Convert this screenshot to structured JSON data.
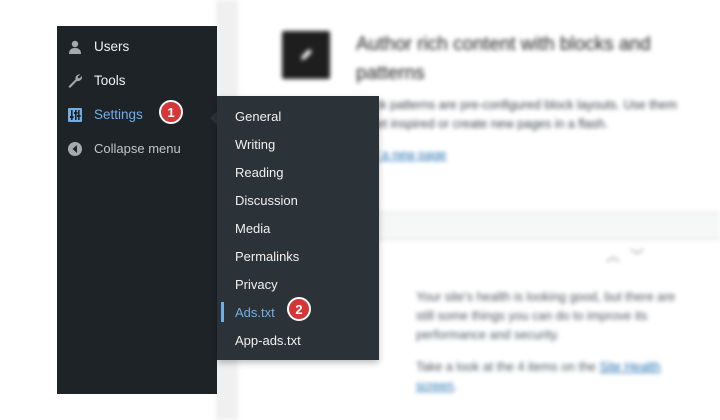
{
  "background": {
    "heading": "Author rich content with blocks and patterns",
    "paragraph": "Block patterns are pre-configured block layouts. Use them to get inspired or create new pages in a flash.",
    "link": "Add a new page",
    "health_text": "Your site’s health is looking good, but there are still some things you can do to improve its performance and security.",
    "health_link_prefix": "Take a look at the 4 items on the",
    "health_link": "Site Health screen",
    "health_link_suffix": "."
  },
  "sidebar": {
    "items": [
      {
        "label": "Users",
        "icon": "users-icon"
      },
      {
        "label": "Tools",
        "icon": "wrench-icon"
      },
      {
        "label": "Settings",
        "icon": "settings-sliders-icon",
        "current": true
      },
      {
        "label": "Collapse menu",
        "icon": "collapse-icon"
      }
    ]
  },
  "submenu": {
    "items": [
      {
        "label": "General"
      },
      {
        "label": "Writing"
      },
      {
        "label": "Reading"
      },
      {
        "label": "Discussion"
      },
      {
        "label": "Media"
      },
      {
        "label": "Permalinks"
      },
      {
        "label": "Privacy"
      },
      {
        "label": "Ads.txt",
        "active": true
      },
      {
        "label": "App-ads.txt"
      }
    ]
  },
  "annotations": {
    "step1": "1",
    "step2": "2"
  },
  "colors": {
    "sidebar_bg": "#1d2327",
    "flyout_bg": "#2c3338",
    "accent": "#72aee6",
    "badge": "#d63638"
  }
}
